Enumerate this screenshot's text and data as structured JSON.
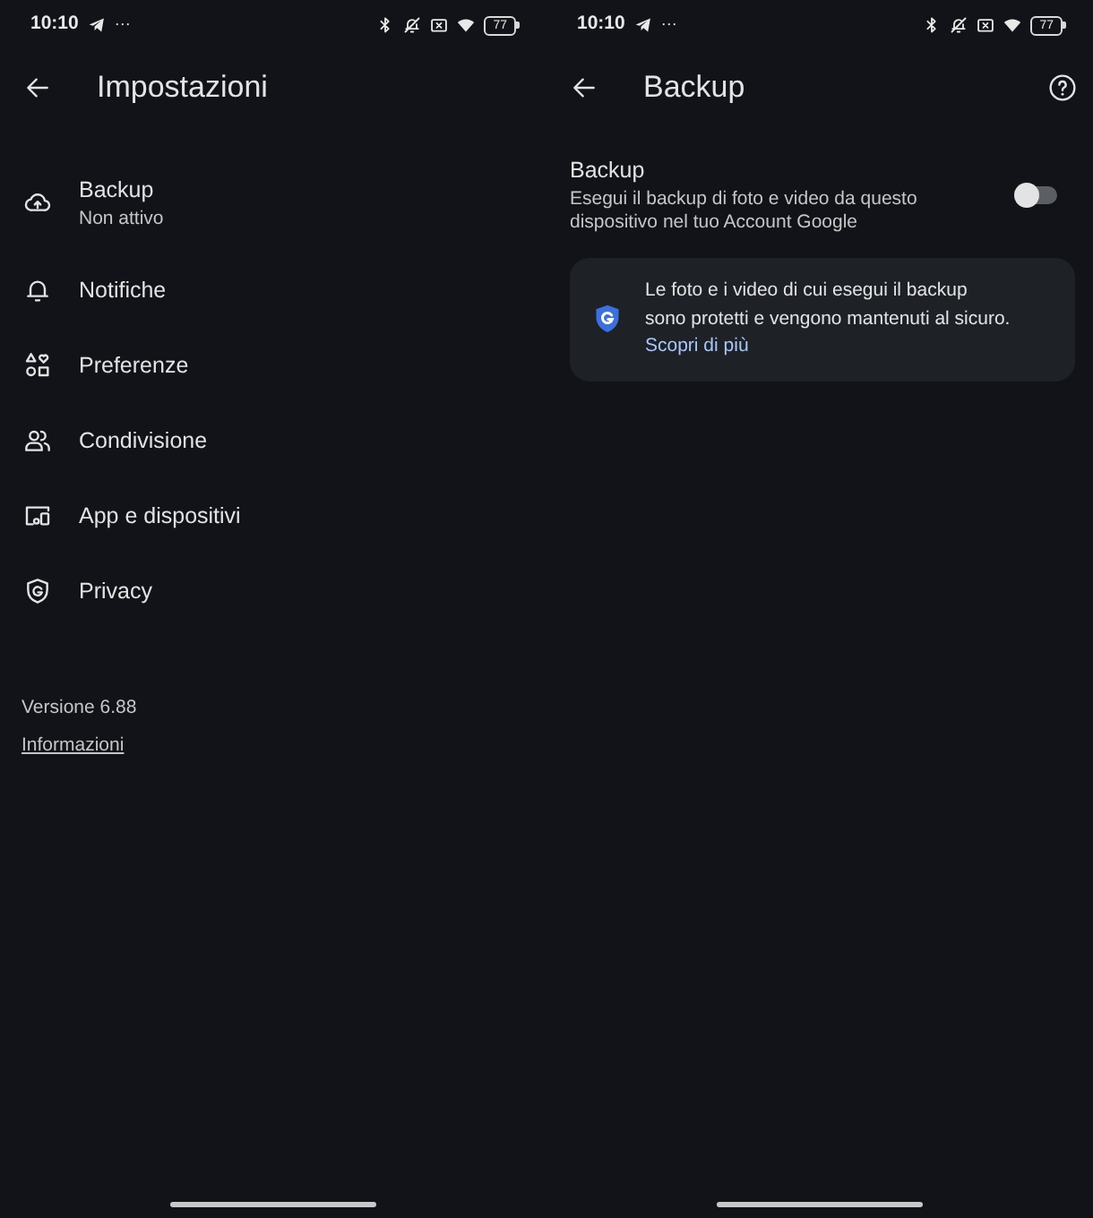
{
  "settings_screen": {
    "status_bar": {
      "time": "10:10",
      "notification_dots": "···",
      "battery": "77"
    },
    "title": "Impostazioni",
    "items": [
      {
        "label": "Backup",
        "subtitle": "Non attivo"
      },
      {
        "label": "Notifiche"
      },
      {
        "label": "Preferenze"
      },
      {
        "label": "Condivisione"
      },
      {
        "label": "App e dispositivi"
      },
      {
        "label": "Privacy"
      }
    ],
    "version": "Versione 6.88",
    "about_link": "Informazioni"
  },
  "backup_screen": {
    "status_bar": {
      "time": "10:10",
      "notification_dots": "···",
      "battery": "77"
    },
    "title": "Backup",
    "backup_setting": {
      "title": "Backup",
      "description": "Esegui il backup di foto e video da questo dispositivo nel tuo Account Google",
      "on": false
    },
    "info_card": {
      "text": "Le foto e i video di cui esegui il backup sono protetti e vengono mantenuti al sicuro.",
      "link": "Scopri di più"
    }
  }
}
